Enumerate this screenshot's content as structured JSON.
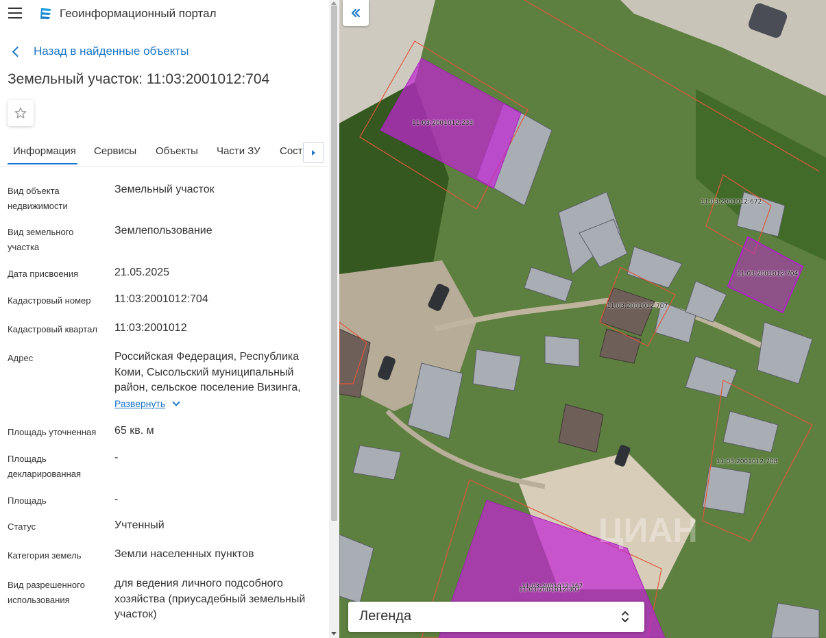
{
  "header": {
    "app_title": "Геоинформационный портал"
  },
  "navigation": {
    "back_label": "Назад в найденные объекты"
  },
  "object": {
    "title": "Земельный участок: 11:03:2001012:704"
  },
  "tabs": [
    {
      "label": "Информация",
      "active": true
    },
    {
      "label": "Сервисы"
    },
    {
      "label": "Объекты"
    },
    {
      "label": "Части ЗУ"
    },
    {
      "label": "Соста"
    }
  ],
  "properties": {
    "object_type": {
      "label": "Вид объекта недвижимости",
      "value": "Земельный участок"
    },
    "parcel_type": {
      "label": "Вид земельного участка",
      "value": "Землепользование"
    },
    "assigned_date": {
      "label": "Дата присвоения",
      "value": "21.05.2025"
    },
    "cadastral_number": {
      "label": "Кадастровый номер",
      "value": "11:03:2001012:704"
    },
    "cadastral_quarter": {
      "label": "Кадастровый квартал",
      "value": "11:03:2001012"
    },
    "address": {
      "label": "Адрес",
      "value": "Российская Федерация, Республика Коми, Сысольский муниципальный район, сельское поселение Визинга,"
    },
    "expand_label": "Развернуть",
    "area_refined": {
      "label": "Площадь уточненная",
      "value": "65 кв. м"
    },
    "area_declared": {
      "label": "Площадь декларированная",
      "value": "-"
    },
    "area": {
      "label": "Площадь",
      "value": "-"
    },
    "status": {
      "label": "Статус",
      "value": "Учтенный"
    },
    "land_category": {
      "label": "Категория земель",
      "value": "Земли населенных пунктов"
    },
    "permitted_use": {
      "label": "Вид разрешенного использования",
      "value": "для ведения личного подсобного хозяйства (приусадебный земельный участок)"
    }
  },
  "map": {
    "parcel_labels": [
      "11:03:2001012:233",
      "11:03:2001012:672",
      "11:03:2001012:704",
      "11:03:2001012:707",
      "11:03:2001012:708",
      "11:03:2001012:167",
      "11:03:2001012:307"
    ],
    "legend_label": "Легенда",
    "watermark": "ЦИАН",
    "highlight_color": "#c026d3",
    "boundary_color": "#e2573b"
  },
  "colors": {
    "accent": "#1976c8"
  },
  "icons": [
    "menu-icon",
    "portal-logo-icon",
    "chevron-left-icon",
    "star-icon",
    "caret-right-icon",
    "chevron-down-icon",
    "double-chevron-left-icon",
    "unfold-icon"
  ]
}
